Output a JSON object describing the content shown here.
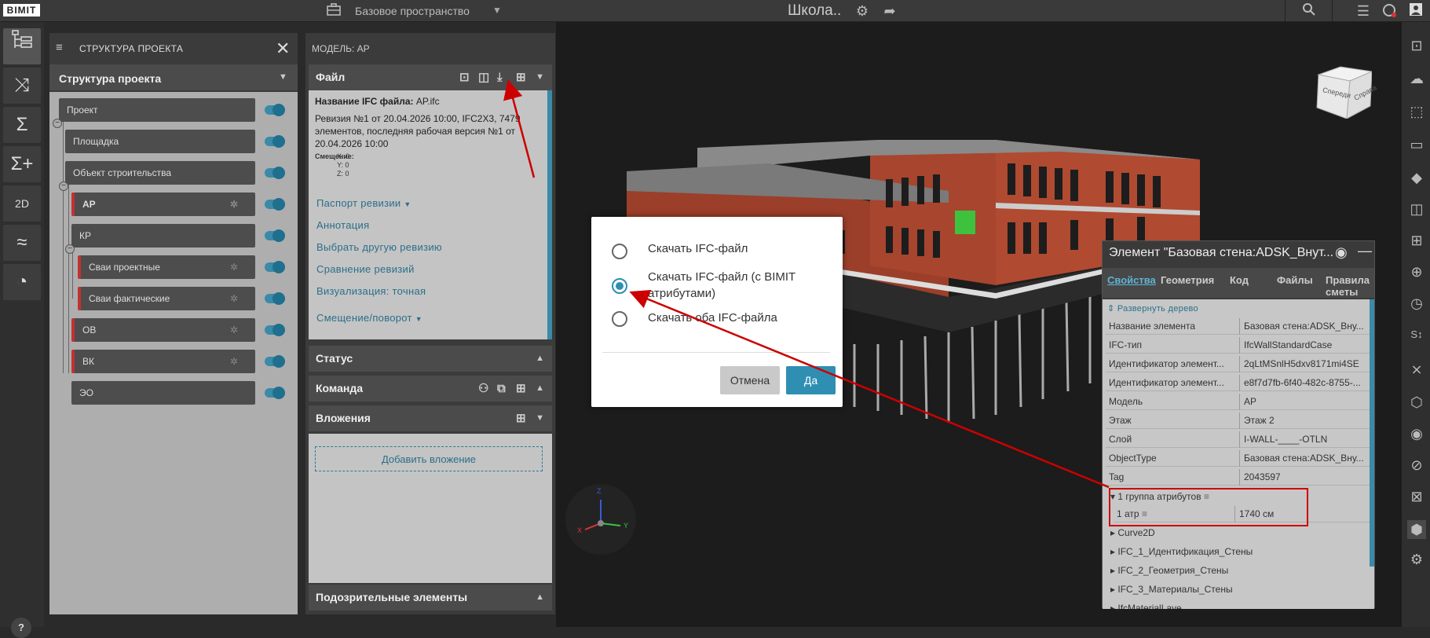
{
  "topbar": {
    "logo": "BIMIT",
    "workspace": "Базовое пространство",
    "project_title": "Школа..",
    "icons": [
      "briefcase-icon",
      "settings-icon",
      "share-icon",
      "search-icon",
      "list-icon",
      "notification-icon",
      "user-icon"
    ]
  },
  "left_tools": [
    "tree-icon",
    "shuffle-icon",
    "sigma-icon",
    "sigma-plus-icon",
    "2d-icon",
    "chart-icon",
    "gauge-icon"
  ],
  "help": "?",
  "structure": {
    "header": "СТРУКТУРА ПРОЕКТА",
    "subheader": "Структура проекта",
    "nodes": [
      {
        "label": "Проект"
      },
      {
        "label": "Площадка"
      },
      {
        "label": "Объект строительства"
      },
      {
        "label": "АР"
      },
      {
        "label": "КР"
      },
      {
        "label": "Сваи проектные"
      },
      {
        "label": "Сваи фактические"
      },
      {
        "label": "ОВ"
      },
      {
        "label": "ВК"
      },
      {
        "label": "ЭО"
      }
    ]
  },
  "model": {
    "header": "МОДЕЛЬ: АР",
    "file_section": "Файл",
    "file_name_label": "Название IFC файла:",
    "file_name": "AP.ifc",
    "revision_text": "Ревизия №1 от 20.04.2026 10:00, IFC2X3, 7479 элементов, последняя рабочая версия №1 от 20.04.2026 10:00",
    "offset_label": "Смещение:",
    "offset_x": "X: 0",
    "offset_y": "Y: 0",
    "offset_z": "Z: 0",
    "links": [
      "Паспорт ревизии",
      "Аннотация",
      "Выбрать другую ревизию",
      "Сравнение ревизий",
      "Визуализация: точная",
      "Смещение/поворот"
    ],
    "status_section": "Статус",
    "team_section": "Команда",
    "attachments_section": "Вложения",
    "add_attachment": "Добавить вложение",
    "suspicious_section": "Подозрительные элементы"
  },
  "cube": {
    "front": "Спереди",
    "right": "Справа"
  },
  "axes": {
    "x": "X",
    "y": "Y",
    "z": "Z"
  },
  "dialog": {
    "options": [
      "Скачать IFC-файл",
      "Скачать IFC-файл (с BIMIT атрибутами)",
      "Скачать оба IFC-файла"
    ],
    "selected_index": 1,
    "cancel": "Отмена",
    "ok": "Да"
  },
  "props": {
    "title": "Элемент \"Базовая стена:ADSK_Внут...",
    "tabs": [
      "Свойства",
      "Геометрия",
      "Код",
      "Файлы",
      "Правила сметы"
    ],
    "expand": "Развернуть дерево",
    "rows": [
      {
        "k": "Название элемента",
        "v": "Базовая стена:ADSK_Вну..."
      },
      {
        "k": "IFC-тип",
        "v": "IfcWallStandardCase"
      },
      {
        "k": "Идентификатор элемент...",
        "v": "2qLtMSnlH5dxv8171mi4SE"
      },
      {
        "k": "Идентификатор элемент...",
        "v": "e8f7d7fb-6f40-482c-8755-..."
      },
      {
        "k": "Модель",
        "v": "АР"
      },
      {
        "k": "Этаж",
        "v": "Этаж 2"
      },
      {
        "k": "Слой",
        "v": "I-WALL-____-OTLN"
      },
      {
        "k": "ObjectType",
        "v": "Базовая стена:ADSK_Вну..."
      },
      {
        "k": "Tag",
        "v": "2043597"
      }
    ],
    "group1": "1 группа атрибутов",
    "attr_k": "1 атр",
    "attr_v": "1740 см",
    "groups": [
      "Curve2D",
      "IFC_1_Идентификация_Стены",
      "IFC_2_Геометрия_Стены",
      "IFC_3_Материалы_Стены",
      "IfcMaterialLaye..."
    ]
  },
  "right_tools": [
    "cube-fit-icon",
    "cloud-icon",
    "select-icon",
    "ruler-icon",
    "plane-icon",
    "section-icon",
    "grid-icon",
    "target-icon",
    "clock-icon",
    "measure-icon",
    "cross-icon",
    "box-icon",
    "eye-icon",
    "eye-off-icon",
    "close-box-icon",
    "shield-icon",
    "settings-box-icon"
  ],
  "colors": {
    "accent": "#2e8fb2",
    "toggle": "#3a8aa8",
    "annotation": "#cc0000"
  }
}
